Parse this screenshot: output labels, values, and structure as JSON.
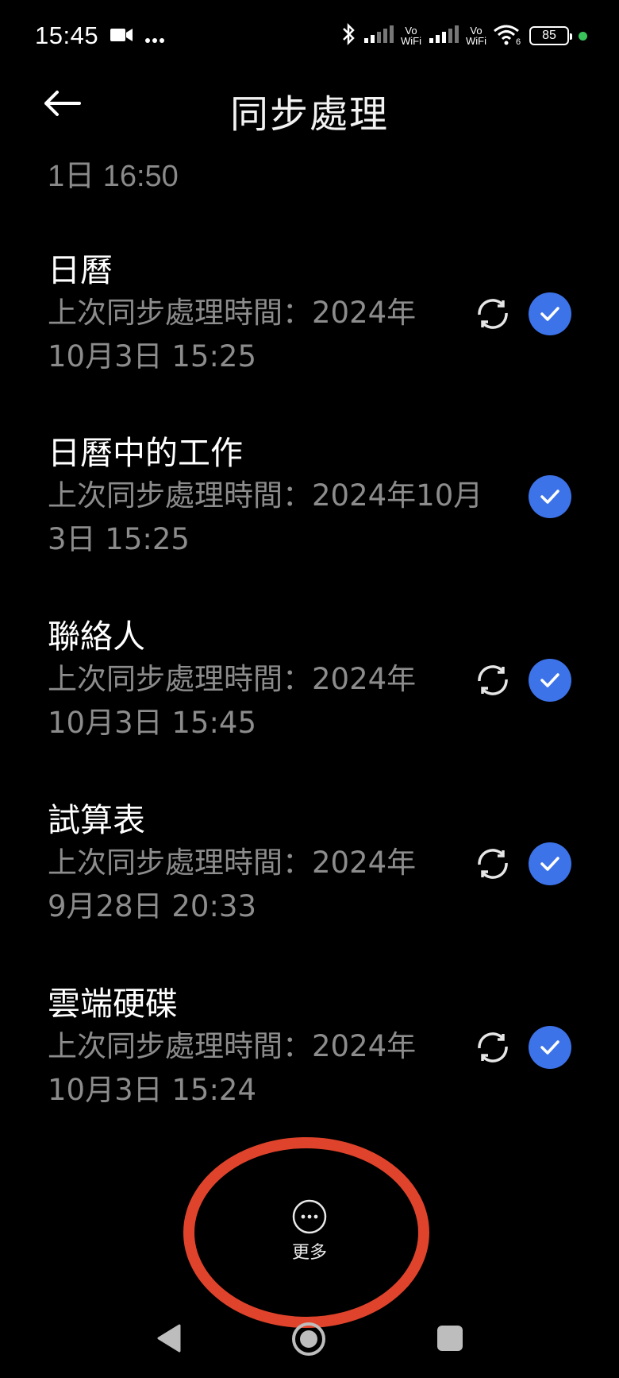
{
  "status_bar": {
    "time": "15:45",
    "signal1_label_top": "Vo",
    "signal1_label_bottom": "WiFi",
    "signal2_label_top": "Vo",
    "signal2_label_bottom": "WiFi",
    "battery": "85",
    "icons": [
      "video-icon",
      "more-dots-icon",
      "bluetooth-icon",
      "signal-icon",
      "wifi-icon",
      "battery-icon"
    ]
  },
  "header": {
    "title": "同步處理"
  },
  "top_partial_text": "1日 16:50",
  "items": [
    {
      "title": "日曆",
      "sub_line1": "上次同步處理時間：2024年",
      "sub_line2": "10月3日 15:25",
      "syncing": true,
      "checked": true
    },
    {
      "title": "日曆中的工作",
      "sub_line1": "上次同步處理時間：2024年10月",
      "sub_line2": "3日 15:25",
      "syncing": false,
      "checked": true
    },
    {
      "title": "聯絡人",
      "sub_line1": "上次同步處理時間：2024年",
      "sub_line2": "10月3日 15:45",
      "syncing": true,
      "checked": true
    },
    {
      "title": "試算表",
      "sub_line1": "上次同步處理時間：2024年",
      "sub_line2": "9月28日 20:33",
      "syncing": true,
      "checked": true
    },
    {
      "title": "雲端硬碟",
      "sub_line1": "上次同步處理時間：2024年",
      "sub_line2": "10月3日 15:24",
      "syncing": true,
      "checked": true
    }
  ],
  "more": {
    "label": "更多"
  },
  "colors": {
    "background": "#000000",
    "check": "#3c73e9",
    "annotation": "#e0432b",
    "subtext": "#8c8c8c"
  }
}
